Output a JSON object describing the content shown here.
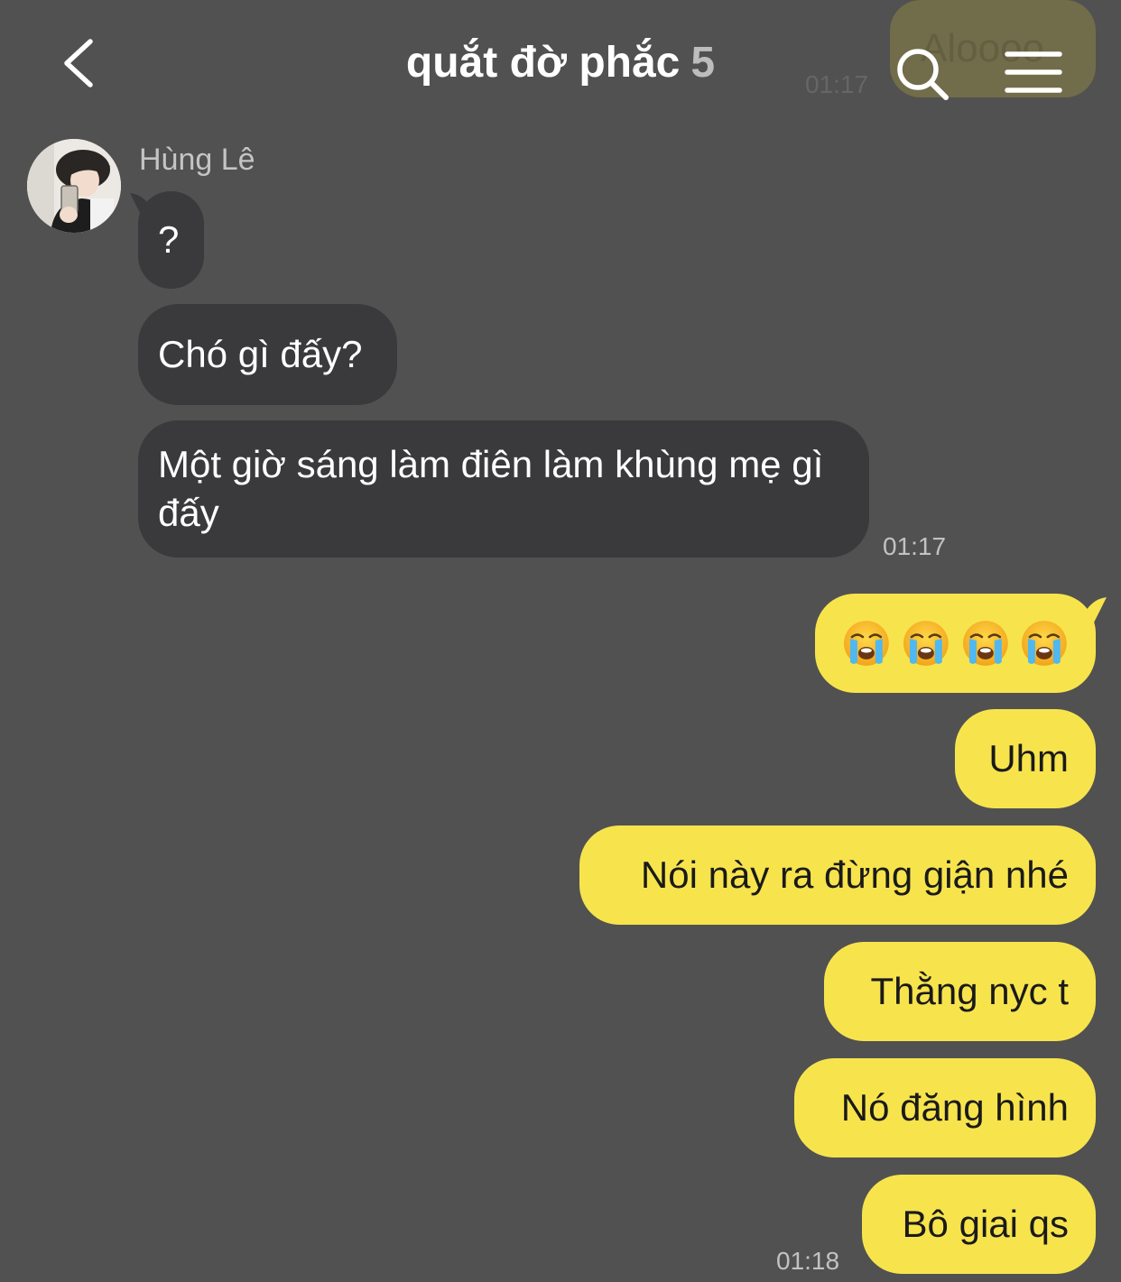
{
  "header": {
    "title": "quắt đờ phắc",
    "member_count": "5",
    "back_icon": "chevron-left-icon",
    "search_icon": "search-icon",
    "menu_icon": "menu-icon"
  },
  "ghost": {
    "text": "Aloooo",
    "time": "01:17"
  },
  "incoming": {
    "sender_name": "Hùng Lê",
    "messages": [
      {
        "text": "?"
      },
      {
        "text": "Chó gì đấy?"
      },
      {
        "text": "Một giờ sáng làm điên làm khùng mẹ gì đấy"
      }
    ],
    "time": "01:17"
  },
  "outgoing": {
    "emoji_count": 4,
    "emoji_name": "loudly-crying-face",
    "messages": [
      {
        "text": "Uhm"
      },
      {
        "text": "Nói này ra đừng giận nhé"
      },
      {
        "text": "Thằng nyc t"
      },
      {
        "text": "Nó đăng hình"
      },
      {
        "text": "Bô giai qs"
      }
    ],
    "time": "01:18"
  },
  "colors": {
    "background": "#515151",
    "incoming_bubble": "#3a3a3c",
    "outgoing_bubble": "#f7e44d"
  }
}
